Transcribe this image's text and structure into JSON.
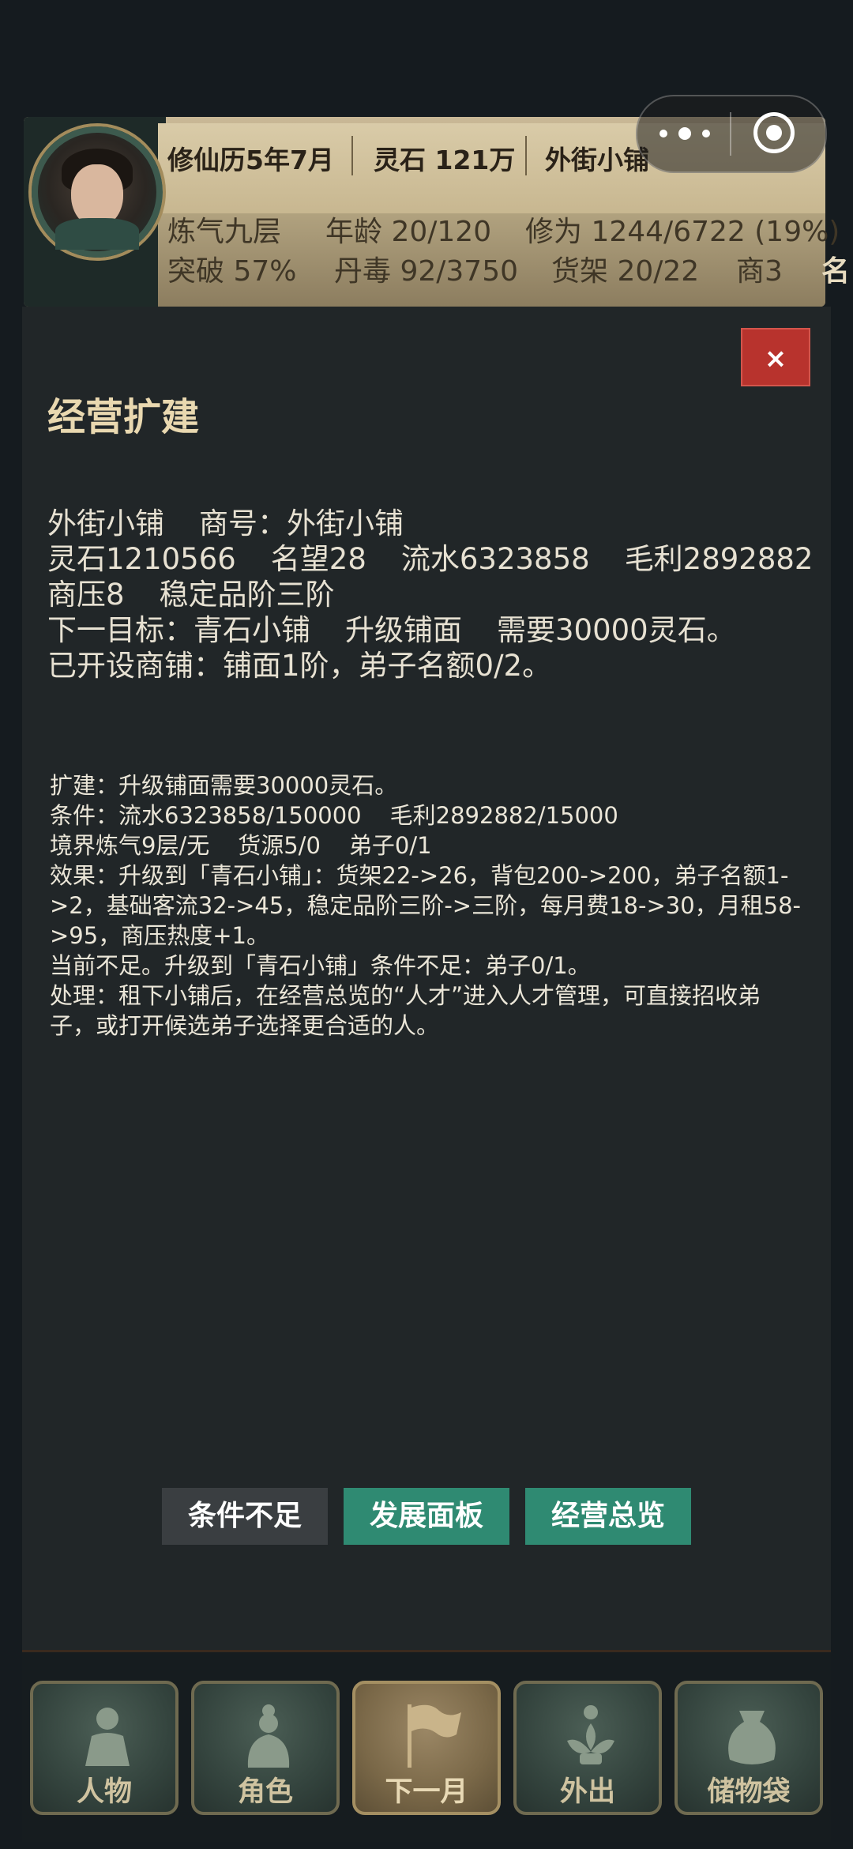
{
  "header": {
    "calendar": "修仙历5年7月",
    "spirit_stones": "灵石 121万",
    "shop_name": "外街小铺",
    "realm": "炼气九层",
    "age": "年龄 20/120",
    "cultivation": "修为 1244/6722 (19%)",
    "breakthrough": "突破 57%",
    "pill_toxin": "丹毒 92/3750",
    "shelves": "货架 20/22",
    "merchant": "商3",
    "cutoff": "名"
  },
  "modal": {
    "close_label": "×",
    "title": "经营扩建",
    "summary": {
      "line1": [
        "外街小铺",
        "商号：外街小铺"
      ],
      "line2": [
        "灵石1210566",
        "名望28",
        "流水6323858",
        "毛利2892882"
      ],
      "line3": [
        "商压8",
        "稳定品阶三阶"
      ],
      "line4": [
        "下一目标：青石小铺",
        "升级铺面",
        "需要30000灵石。"
      ],
      "line5": "已开设商铺：铺面1阶，弟子名额0/2。"
    },
    "details": {
      "expand": "扩建：升级铺面需要30000灵石。",
      "conditions": [
        "条件：流水6323858/150000",
        "毛利2892882/15000"
      ],
      "requirements": [
        "境界炼气9层/无",
        "货源5/0",
        "弟子0/1"
      ],
      "effect": "效果：升级到「青石小铺」：货架22->26，背包200->200，弟子名额1->2，基础客流32->45，稳定品阶三阶->三阶，每月费18->30，月租58->95，商压热度+1。",
      "status": "当前不足。升级到「青石小铺」条件不足：弟子0/1。",
      "handling": "处理：租下小铺后，在经营总览的“人才”进入人才管理，可直接招收弟子，或打开候选弟子选择更合适的人。"
    },
    "buttons": {
      "insufficient": "条件不足",
      "dev_panel": "发展面板",
      "overview": "经营总览"
    }
  },
  "nav": {
    "items": [
      {
        "label": "人物",
        "icon": "person-icon"
      },
      {
        "label": "角色",
        "icon": "character-icon"
      },
      {
        "label": "下一月",
        "icon": "flag-icon"
      },
      {
        "label": "外出",
        "icon": "lotus-icon"
      },
      {
        "label": "储物袋",
        "icon": "bag-icon"
      }
    ]
  }
}
